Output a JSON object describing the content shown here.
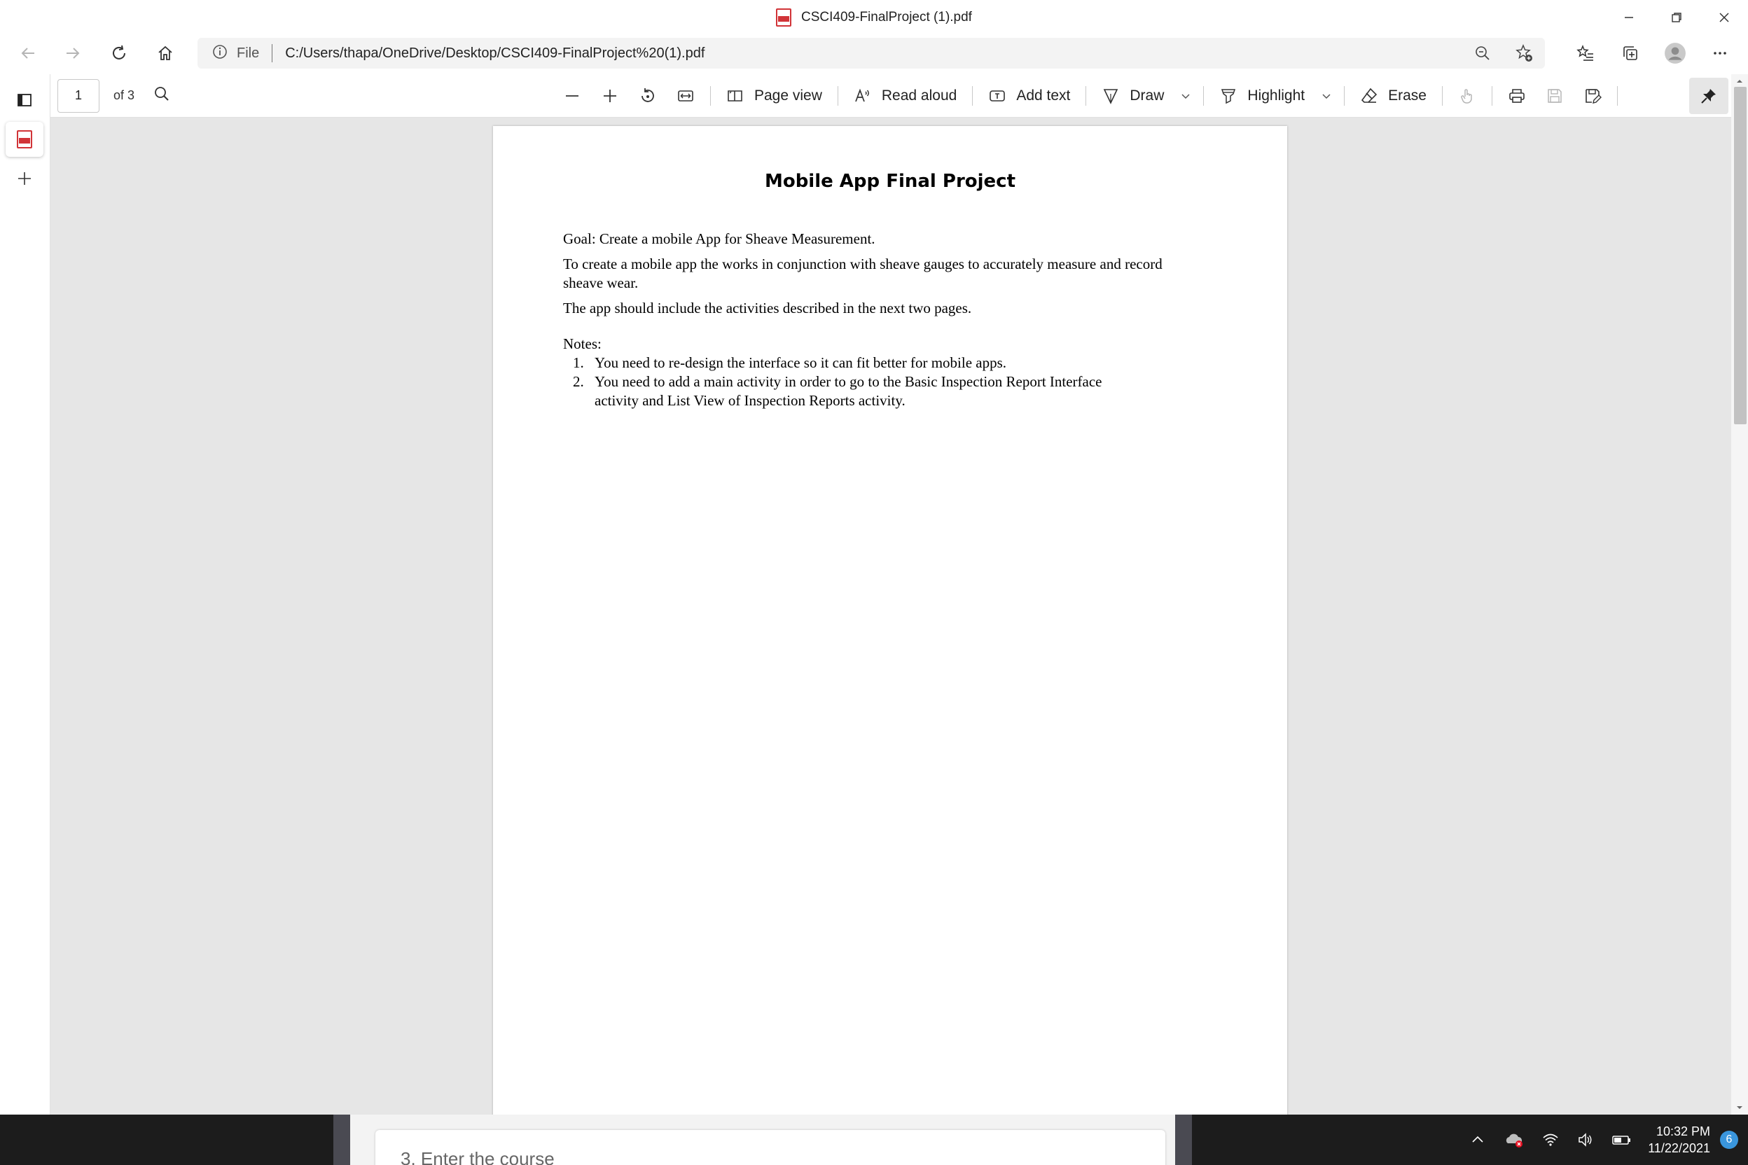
{
  "window": {
    "title": "CSCI409-FinalProject (1).pdf"
  },
  "address_bar": {
    "scheme_label": "File",
    "url": "C:/Users/thapa/OneDrive/Desktop/CSCI409-FinalProject%20(1).pdf"
  },
  "pdf_toolbar": {
    "page_current": "1",
    "page_total": "of 3",
    "page_view": "Page view",
    "read_aloud": "Read aloud",
    "add_text": "Add text",
    "draw": "Draw",
    "highlight": "Highlight",
    "erase": "Erase"
  },
  "document": {
    "title": "Mobile App Final Project",
    "goal": "Goal: Create a mobile App for Sheave Measurement.",
    "description_line1": "To create a mobile app the works in conjunction with sheave gauges to accurately measure and record",
    "description_line2": "sheave wear.",
    "activities": "The app should include the activities described in the next two pages.",
    "notes_heading": "Notes:",
    "notes": [
      {
        "num": "1.",
        "line1": "You need to re-design the interface so it can fit better for mobile apps.",
        "line2": ""
      },
      {
        "num": "2.",
        "line1": "You need to add a main activity in order to go to the Basic Inspection Report Interface",
        "line2": "activity and List View of Inspection Reports activity."
      }
    ]
  },
  "taskbar": {
    "window_snippet": "3. Enter the course",
    "time": "10:32 PM",
    "date": "11/22/2021",
    "notification_count": "6"
  },
  "icons": {
    "back": "arrow-left-icon",
    "forward": "arrow-right-icon",
    "refresh": "refresh-icon",
    "home": "home-icon",
    "info": "info-icon",
    "zoom": "zoom-icon",
    "favorite_add": "star-add-icon",
    "favorites": "favorites-icon",
    "collections": "collections-icon",
    "profile": "profile-avatar-icon",
    "more": "ellipsis-icon"
  },
  "colors": {
    "pdf_red": "#d13438",
    "viewer_bg": "#e6e6e6",
    "taskbar_bg": "#1c1c1c",
    "badge_blue": "#3a96dd"
  }
}
